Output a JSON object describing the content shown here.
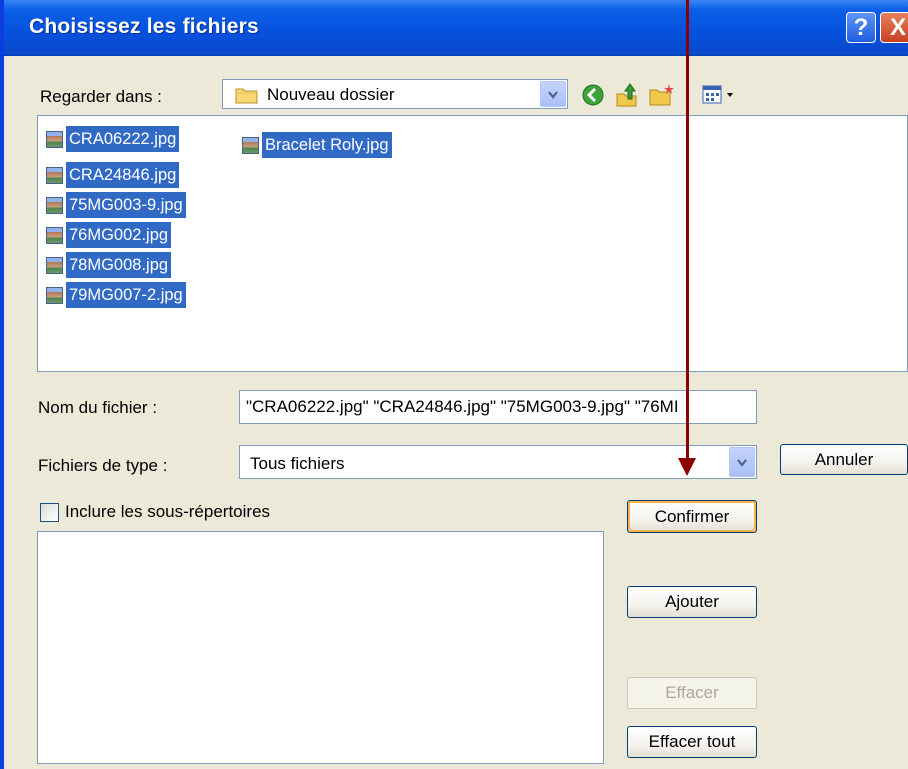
{
  "title": "Choisissez les fichiers",
  "titlebar_buttons": {
    "help": "?",
    "close": "X"
  },
  "look_in": {
    "label": "Regarder dans :",
    "value": "Nouveau dossier"
  },
  "toolbar_icons": [
    "back-icon",
    "up-folder-icon",
    "new-folder-icon",
    "view-menu-icon"
  ],
  "files": [
    "CRA06222.jpg",
    "CRA24846.jpg",
    "75MG003-9.jpg",
    "76MG002.jpg",
    "78MG008.jpg",
    "79MG007-2.jpg",
    "Bracelet Roly.jpg"
  ],
  "file_name": {
    "label": "Nom du fichier :",
    "value": "\"CRA06222.jpg\" \"CRA24846.jpg\" \"75MG003-9.jpg\" \"76MI"
  },
  "file_type": {
    "label": "Fichiers de type :",
    "value": "Tous fichiers"
  },
  "subdirs_label": "Inclure les sous-répertoires",
  "buttons": {
    "cancel": "Annuler",
    "confirm": "Confirmer",
    "add": "Ajouter",
    "clear": "Effacer",
    "clear_all": "Effacer tout"
  },
  "colors": {
    "titlebar": "#0551de",
    "selection": "#316ac5",
    "annotation_arrow": "#8b0000",
    "dialog_bg": "#ece9d8"
  }
}
